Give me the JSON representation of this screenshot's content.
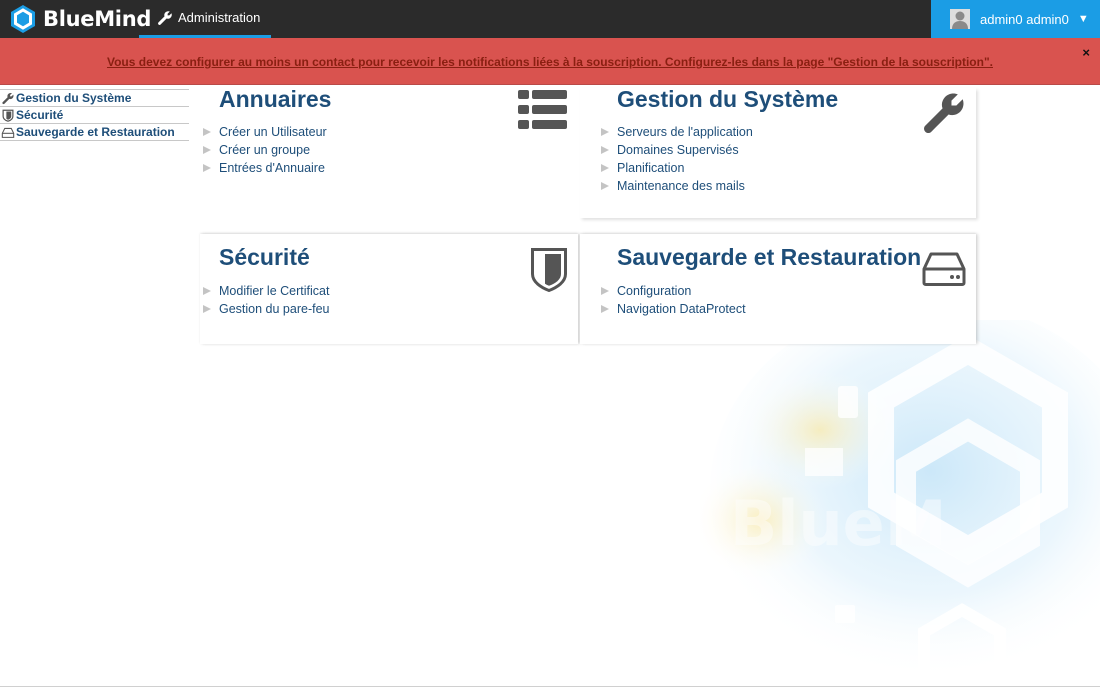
{
  "header": {
    "brand": "BlueMind",
    "nav_label": "Administration",
    "user_name": "admin0 admin0",
    "user_caret": "▼"
  },
  "alert": {
    "message": "Vous devez configurer au moins un contact pour recevoir les notifications liées à la souscription. Configurez-les dans la page \"Gestion de la souscription\".",
    "close": "×"
  },
  "sidebar": {
    "items": [
      {
        "label": "Gestion du Système",
        "icon": "wrench-icon"
      },
      {
        "label": "Sécurité",
        "icon": "shield-icon"
      },
      {
        "label": "Sauvegarde et Restauration",
        "icon": "harddrive-icon"
      }
    ]
  },
  "cards": [
    {
      "title": "Annuaires",
      "icon": "list-icon",
      "links": [
        "Créer un Utilisateur",
        "Créer un groupe",
        "Entrées d'Annuaire"
      ]
    },
    {
      "title": "Gestion du Système",
      "icon": "wrench-icon",
      "links": [
        "Serveurs de l'application",
        "Domaines Supervisés",
        "Planification",
        "Maintenance des mails"
      ]
    },
    {
      "title": "Sécurité",
      "icon": "shield-icon",
      "links": [
        "Modifier le Certificat",
        "Gestion du pare-feu"
      ]
    },
    {
      "title": "Sauvegarde et Restauration",
      "icon": "harddrive-icon",
      "links": [
        "Configuration",
        "Navigation DataProtect"
      ]
    }
  ],
  "colors": {
    "topbar": "#2b2b2b",
    "accent": "#1b9de5",
    "alert_bg": "#d9534f",
    "title_blue": "#1e4e79"
  }
}
